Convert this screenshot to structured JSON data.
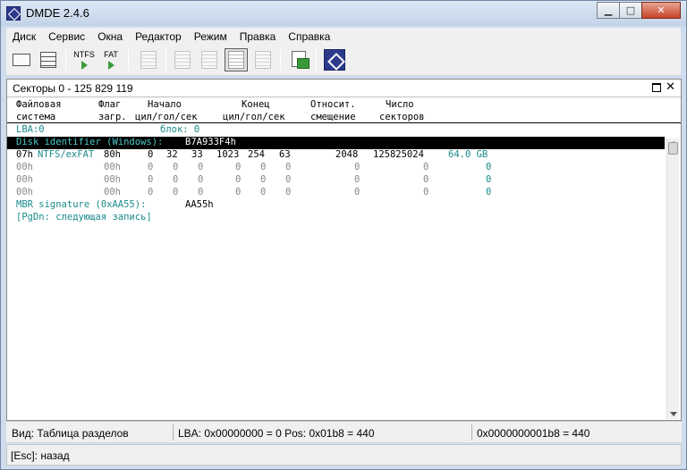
{
  "window": {
    "title": "DMDE 2.4.6"
  },
  "menu": [
    "Диск",
    "Сервис",
    "Окна",
    "Редактор",
    "Режим",
    "Правка",
    "Справка"
  ],
  "toolbar": {
    "ntfs_label": "NTFS",
    "fat_label": "FAT"
  },
  "panel": {
    "title": "Секторы 0 - 125 829 119"
  },
  "columns": {
    "fs": [
      "Файловая",
      "система"
    ],
    "flag": [
      "Флаг",
      "загр."
    ],
    "start": [
      "Начало",
      "цил/гол/сек"
    ],
    "end": [
      "Конец",
      "цил/гол/сек"
    ],
    "offset": [
      "Относит.",
      "смещение"
    ],
    "count": [
      "Число",
      "секторов"
    ]
  },
  "lba_row": {
    "lba": "LBA:0",
    "block": "блок: 0"
  },
  "disk_id": {
    "label": "Disk identifier (Windows):",
    "value": "B7A933F4h"
  },
  "partitions": [
    {
      "type": "07h",
      "fs": "NTFS/exFAT",
      "flag": "80h",
      "sc": "0",
      "sh": "32",
      "ss": "33",
      "ec": "1023",
      "eh": "254",
      "es": "63",
      "offset": "2048",
      "count": "125825024",
      "size": "64.0 GB"
    },
    {
      "type": "00h",
      "fs": "",
      "flag": "00h",
      "sc": "0",
      "sh": "0",
      "ss": "0",
      "ec": "0",
      "eh": "0",
      "es": "0",
      "offset": "0",
      "count": "0",
      "size": "0"
    },
    {
      "type": "00h",
      "fs": "",
      "flag": "00h",
      "sc": "0",
      "sh": "0",
      "ss": "0",
      "ec": "0",
      "eh": "0",
      "es": "0",
      "offset": "0",
      "count": "0",
      "size": "0"
    },
    {
      "type": "00h",
      "fs": "",
      "flag": "00h",
      "sc": "0",
      "sh": "0",
      "ss": "0",
      "ec": "0",
      "eh": "0",
      "es": "0",
      "offset": "0",
      "count": "0",
      "size": "0"
    }
  ],
  "mbr": {
    "label": "MBR signature (0xAA55):",
    "value": "AA55h"
  },
  "pgdn": "[PgDn: следующая запись]",
  "status": {
    "view": "Вид: Таблица разделов",
    "position": "LBA: 0x00000000 = 0  Pos: 0x01b8 = 440",
    "offset": "0x0000000001b8 = 440"
  },
  "hint": "[Esc]: назад",
  "colors": {
    "teal": "#1a8a8a",
    "selection": "#000000"
  }
}
